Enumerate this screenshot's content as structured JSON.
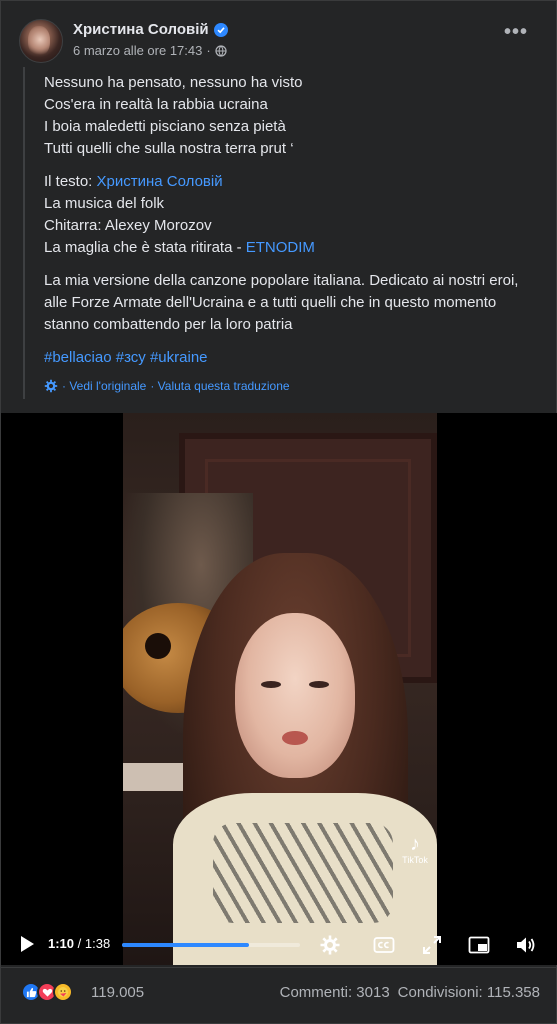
{
  "post": {
    "author": "Христина Соловій",
    "timestamp": "6 marzo alle ore 17:43",
    "separator": "·",
    "more_label": "•••"
  },
  "body": {
    "lyrics": [
      "Nessuno ha pensato, nessuno ha visto",
      "Cos'era in realtà la rabbia ucraina",
      "I boia maledetti pisciano senza pietà",
      "Tutti quelli che sulla nostra terra prut ‘"
    ],
    "credits": {
      "text_label": "Il testo: ",
      "text_link": "Христина Соловій",
      "music": "La musica del folk",
      "guitar": "Chitarra: Alexey Morozov",
      "shirt_label": "La maglia che è stata ritirata - ",
      "shirt_link": "ETNODIM"
    },
    "description": "La mia versione della canzone popolare italiana. Dedicato ai nostri eroi, alle Forze Armate dell'Ucraina e a tutti quelli che in questo momento stanno combattendo per la loro patria",
    "hashtags": [
      "#bellaciao",
      "#зсу",
      "#ukraine"
    ],
    "translation": {
      "see_original": "· Vedi l'originale",
      "rate": "· Valuta questa traduzione"
    }
  },
  "video": {
    "current_time": "1:10",
    "separator": " / ",
    "duration": "1:38",
    "progress": 0.714,
    "watermark": "TikTok",
    "icons": [
      "play-icon",
      "gear-icon",
      "cc-icon",
      "expand-icon",
      "pip-icon",
      "volume-icon"
    ]
  },
  "footer": {
    "reaction_count": "119.005",
    "comments": "Commenti: 3013",
    "shares": "Condivisioni: 115.358"
  },
  "colors": {
    "background": "#242526",
    "text": "#e4e6eb",
    "secondary": "#b0b3b8",
    "link": "#4599ff",
    "accent": "#2d88ff"
  }
}
